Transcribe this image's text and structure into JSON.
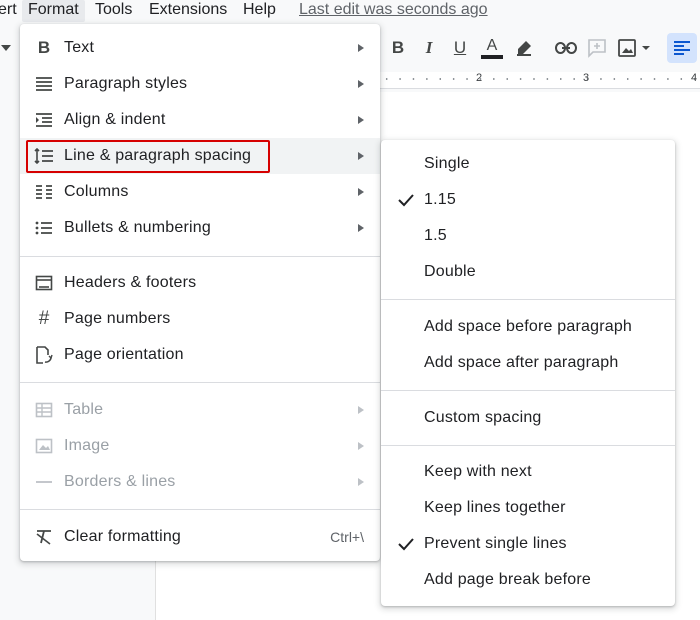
{
  "menubar": {
    "items": [
      "ert",
      "Format",
      "Tools",
      "Extensions",
      "Help"
    ],
    "last_edit": "Last edit was seconds ago"
  },
  "toolbar": {
    "icons": [
      "dropdown-caret-icon",
      "bold-icon",
      "italic-icon",
      "underline-icon",
      "text-color-icon",
      "highlight-icon",
      "link-icon",
      "add-comment-icon",
      "insert-image-icon",
      "align-left-icon"
    ],
    "text_color_bar": "#202124",
    "bold": "B",
    "italic": "I",
    "underline": "U",
    "text_color": "A"
  },
  "ruler": {
    "marks": [
      "2",
      "3",
      "4"
    ]
  },
  "format_menu": {
    "items": [
      {
        "label": "Text",
        "icon": "bold-b-icon",
        "submenu": true
      },
      {
        "label": "Paragraph styles",
        "icon": "paragraph-styles-icon",
        "submenu": true
      },
      {
        "label": "Align & indent",
        "icon": "indent-icon",
        "submenu": true
      },
      {
        "label": "Line & paragraph spacing",
        "icon": "line-spacing-icon",
        "submenu": true,
        "active": true
      },
      {
        "label": "Columns",
        "icon": "columns-icon",
        "submenu": true
      },
      {
        "label": "Bullets & numbering",
        "icon": "bulleted-list-icon",
        "submenu": true
      },
      {
        "label": "Headers & footers",
        "icon": "header-footer-icon"
      },
      {
        "label": "Page numbers",
        "icon": "hash-icon"
      },
      {
        "label": "Page orientation",
        "icon": "page-orientation-icon"
      },
      {
        "label": "Table",
        "icon": "table-icon",
        "submenu": true,
        "disabled": true
      },
      {
        "label": "Image",
        "icon": "image-icon",
        "submenu": true,
        "disabled": true
      },
      {
        "label": "Borders & lines",
        "icon": "border-line-icon",
        "submenu": true,
        "disabled": true
      },
      {
        "label": "Clear formatting",
        "icon": "clear-formatting-icon",
        "shortcut": "Ctrl+\\"
      }
    ],
    "highlight_color": "#d60000"
  },
  "spacing_menu": {
    "items": [
      {
        "label": "Single",
        "checked": false
      },
      {
        "label": "1.15",
        "checked": true
      },
      {
        "label": "1.5",
        "checked": false
      },
      {
        "label": "Double",
        "checked": false
      },
      {
        "label": "Add space before paragraph",
        "checked": false
      },
      {
        "label": "Add space after paragraph",
        "checked": false
      },
      {
        "label": "Custom spacing",
        "checked": false
      },
      {
        "label": "Keep with next",
        "checked": false
      },
      {
        "label": "Keep lines together",
        "checked": false
      },
      {
        "label": "Prevent single lines",
        "checked": true
      },
      {
        "label": "Add page break before",
        "checked": false
      }
    ]
  }
}
